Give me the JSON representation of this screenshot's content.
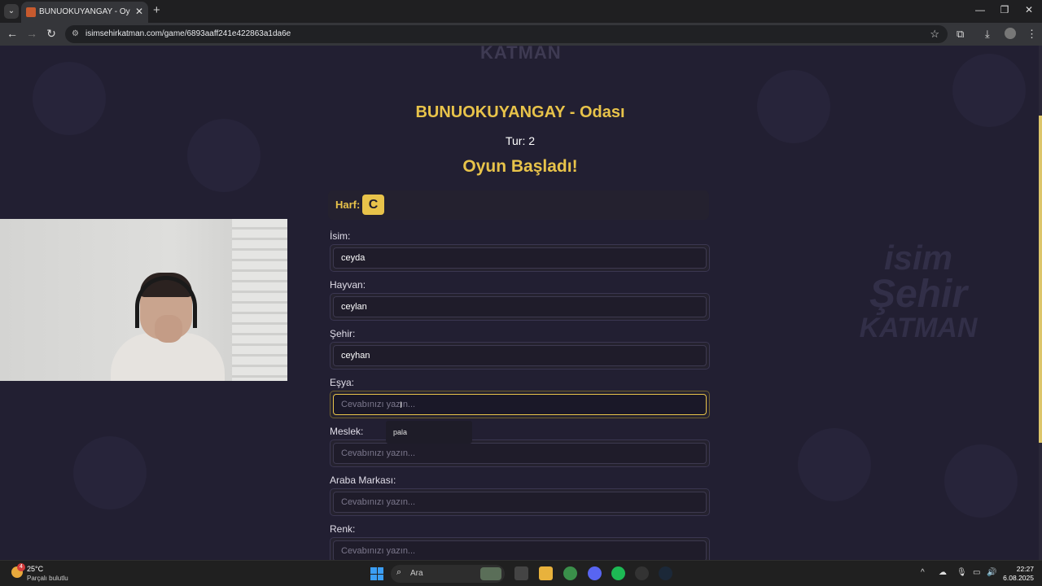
{
  "browser": {
    "tab_title": "BUNUOKUYANGAY - Oyun Ekra",
    "url": "isimsehirkatman.com/game/6893aaff241e422863a1da6e"
  },
  "page": {
    "logo_top": "KATMAN",
    "logo_right": {
      "line1": "isim",
      "line2": "Şehir",
      "line3": "KATMAN"
    },
    "room_title": "BUNUOKUYANGAY - Odası",
    "round": "Tur: 2",
    "game_status": "Oyun Başladı!",
    "letter_label": "Harf:",
    "letter": "C",
    "placeholder": "Cevabınızı yazın...",
    "fields": [
      {
        "label": "İsim:",
        "value": "ceyda"
      },
      {
        "label": "Hayvan:",
        "value": "ceylan"
      },
      {
        "label": "Şehir:",
        "value": "ceyhan"
      },
      {
        "label": "Eşya:",
        "value": ""
      },
      {
        "label": "Meslek:",
        "value": ""
      },
      {
        "label": "Araba Markası:",
        "value": ""
      },
      {
        "label": "Renk:",
        "value": ""
      }
    ],
    "autocomplete_suggestion": "pala"
  },
  "taskbar": {
    "temperature": "25°C",
    "weather_condition": "Parçalı bulutlu",
    "weather_badge": "4",
    "search_placeholder": "Ara",
    "time": "22:27",
    "date": "6.08.2025"
  },
  "colors": {
    "accent": "#e8c34a",
    "page_bg": "#221f32"
  }
}
